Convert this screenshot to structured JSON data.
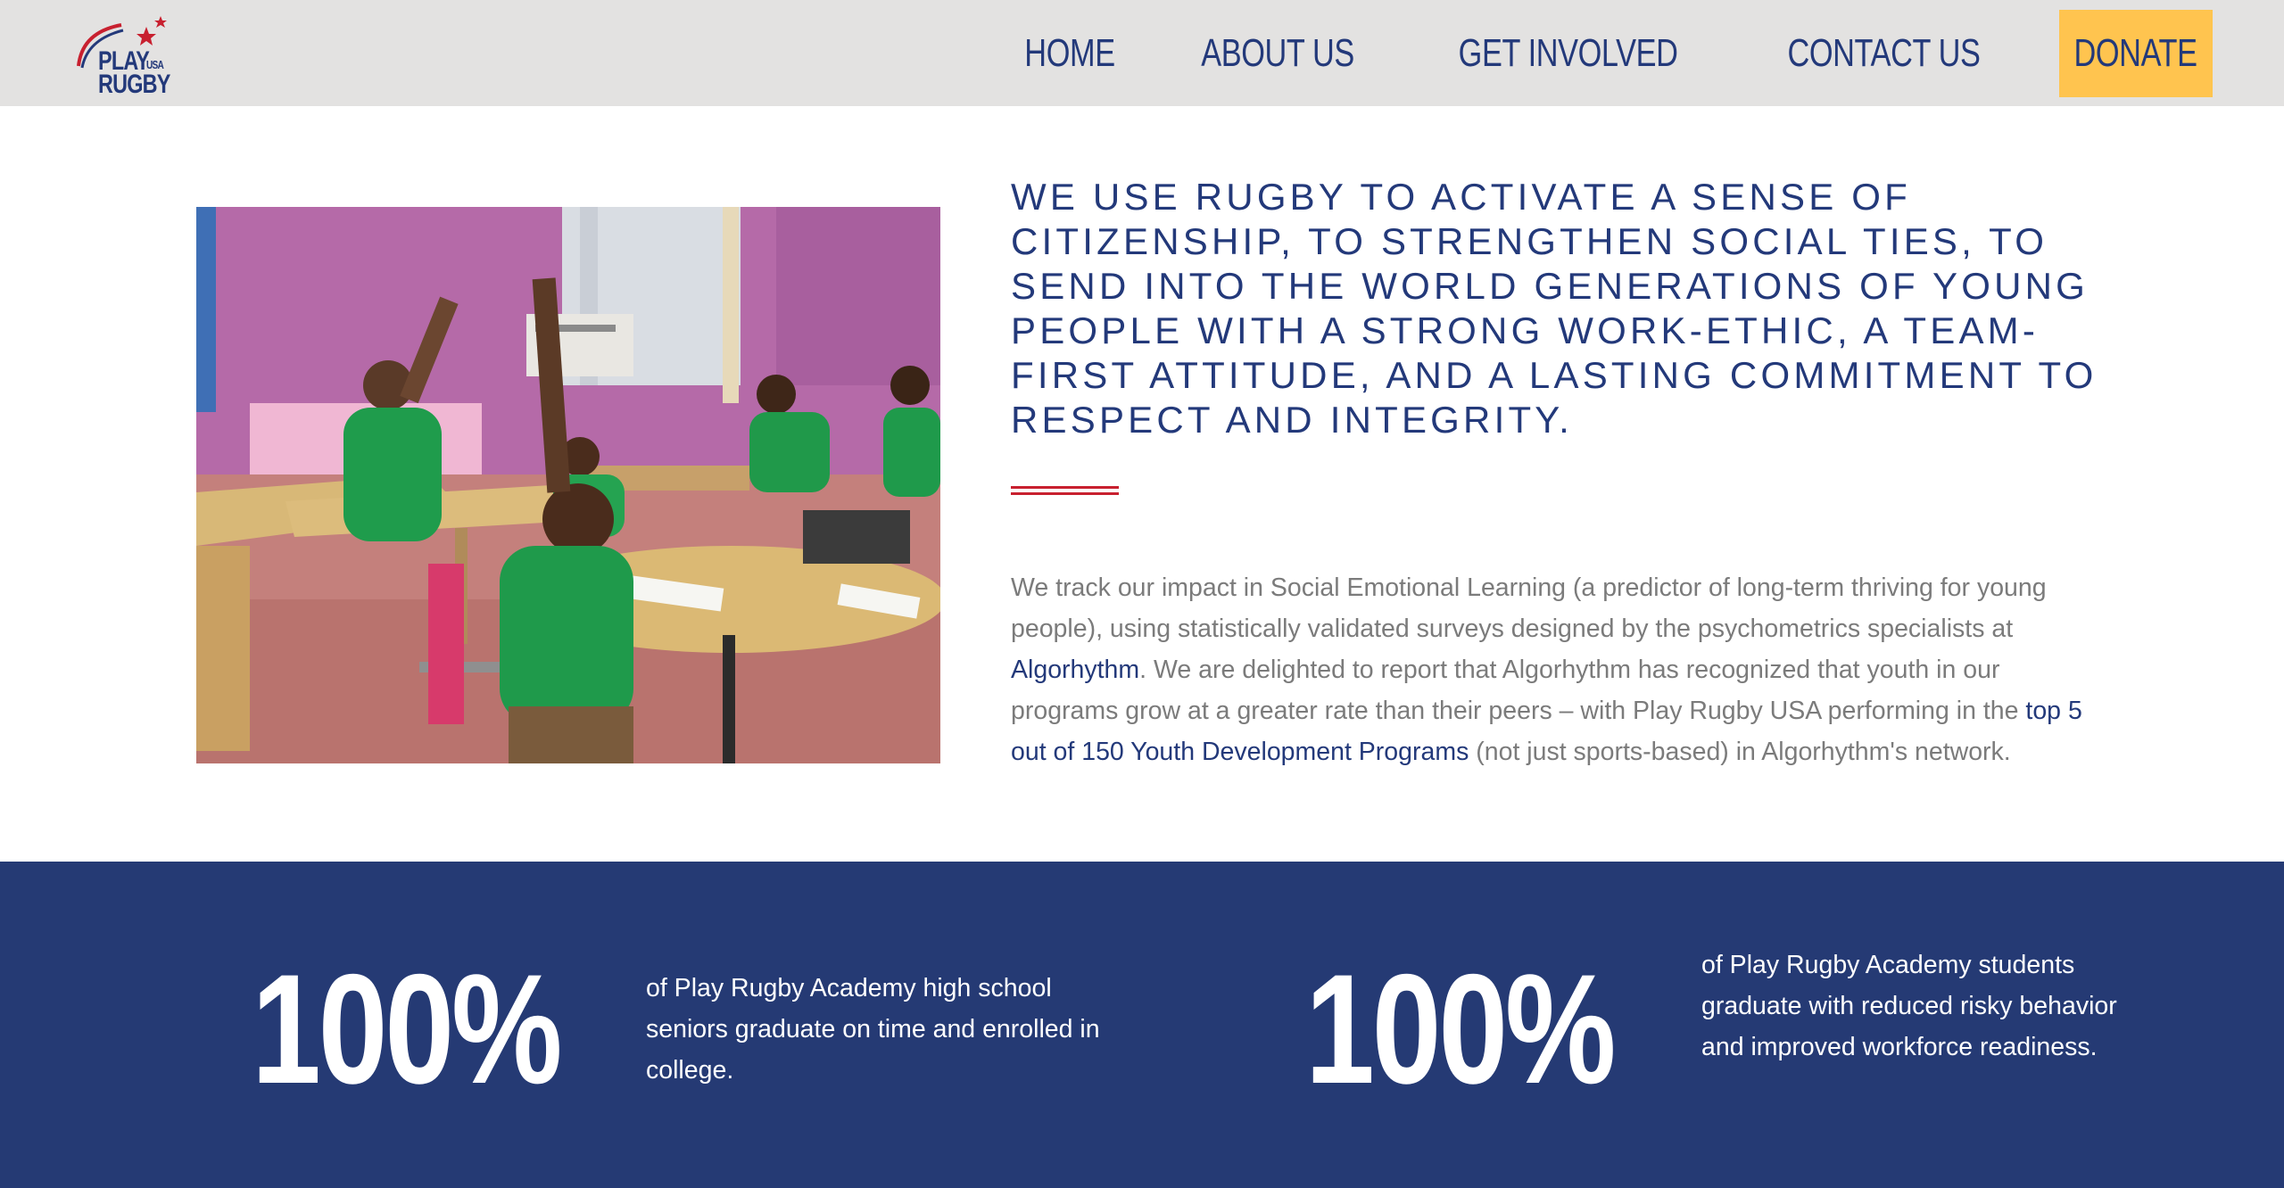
{
  "header": {
    "logo": {
      "play": "PLAY",
      "usa": "USA",
      "rugby": "RUGBY"
    },
    "nav": [
      {
        "label": "HOME"
      },
      {
        "label": "ABOUT US"
      },
      {
        "label": "GET INVOLVED"
      },
      {
        "label": "CONTACT US"
      }
    ],
    "donate_label": "DONATE"
  },
  "intro": {
    "headline": "We use rugby to activate a sense of citizenship, to strengthen social ties, to send into the world generations of young people with a strong work-ethic, a team-first attitude, and a lasting commitment to respect and integrity.",
    "body": {
      "part1": "We track our impact in Social Emotional Learning (a predictor of long-term thriving for young people), using statistically validated surveys designed by the psychometrics specialists at ",
      "link1": "Algorhythm",
      "part2": ". We are delighted to report that Algorhythm has recognized that youth in our programs grow at a greater rate than their peers – with Play Rugby USA performing in the ",
      "link2": "top 5 out of 150 Youth Development Programs",
      "part3": " (not just sports-based) in Algorhythm's network."
    }
  },
  "stats": [
    {
      "number": "100%",
      "text": "of Play Rugby Academy high school seniors graduate on time and enrolled in college."
    },
    {
      "number": "100%",
      "text": "of Play Rugby Academy students graduate with reduced risky behavior and improved workforce readiness."
    }
  ],
  "colors": {
    "navy": "#23397a",
    "band": "#253a74",
    "donate": "#ffc44f",
    "accent_red": "#c8202f",
    "header_bg": "#e3e2e1",
    "body_gray": "#7b7b7b"
  }
}
